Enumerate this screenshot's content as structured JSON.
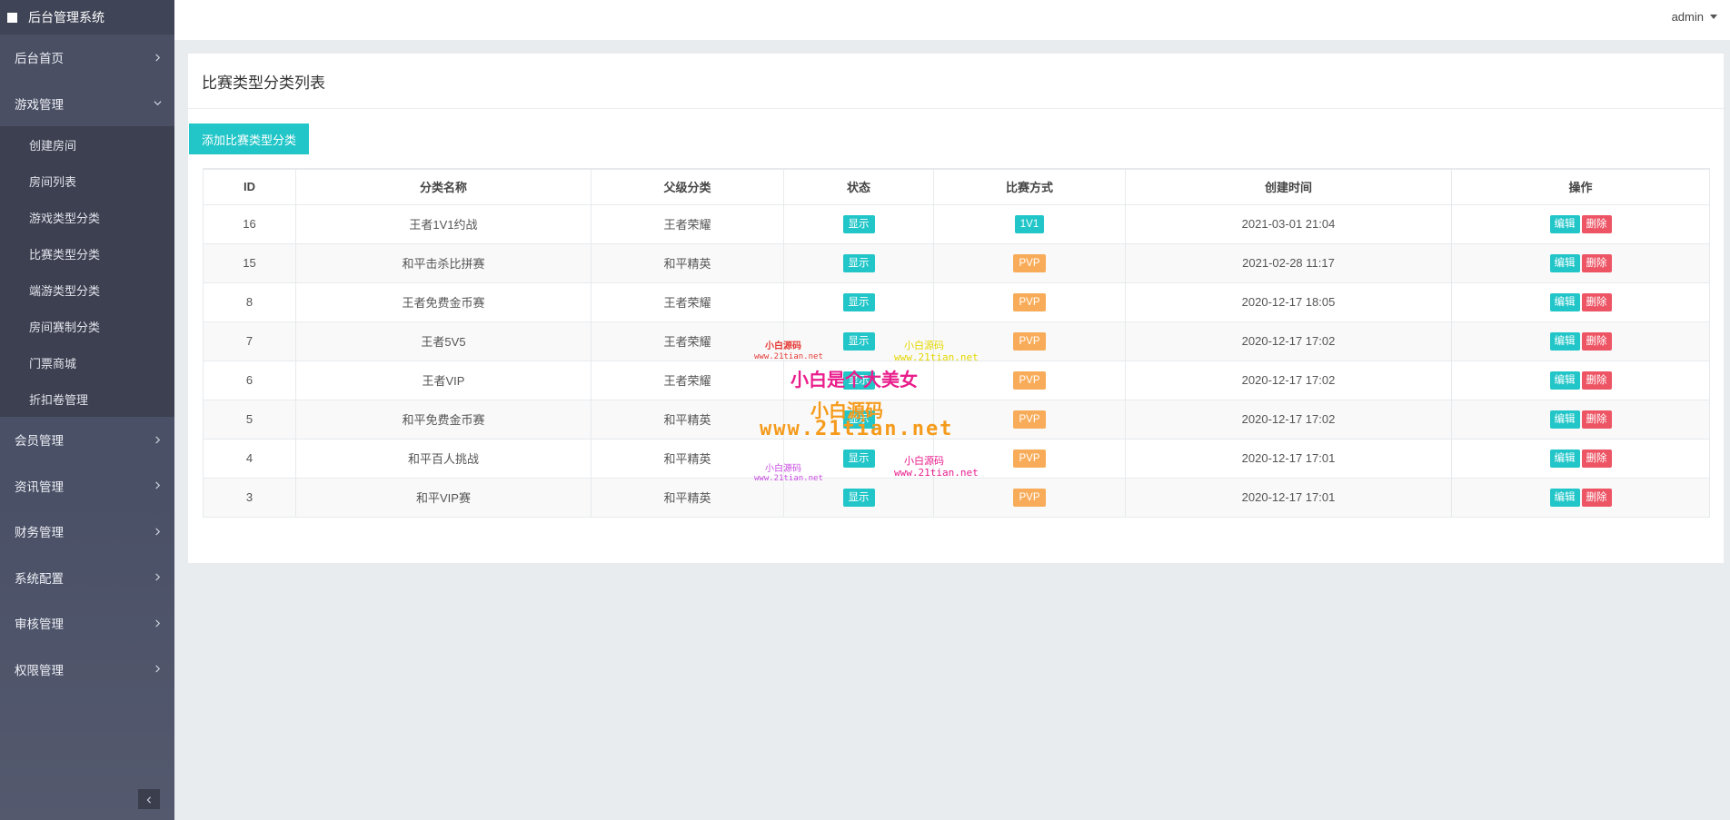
{
  "app": {
    "title": "后台管理系统"
  },
  "sidebar": {
    "items": [
      {
        "label": "后台首页"
      },
      {
        "label": "游戏管理",
        "expanded": true,
        "children": [
          "创建房间",
          "房间列表",
          "游戏类型分类",
          "比赛类型分类",
          "端游类型分类",
          "房间赛制分类",
          "门票商城",
          "折扣卷管理"
        ]
      },
      {
        "label": "会员管理"
      },
      {
        "label": "资讯管理"
      },
      {
        "label": "财务管理"
      },
      {
        "label": "系统配置"
      },
      {
        "label": "审核管理"
      },
      {
        "label": "权限管理"
      }
    ]
  },
  "header": {
    "user": "admin"
  },
  "page": {
    "title": "比赛类型分类列表",
    "add_button": "添加比赛类型分类"
  },
  "table": {
    "columns": [
      "ID",
      "分类名称",
      "父级分类",
      "状态",
      "比赛方式",
      "创建时间",
      "操作"
    ],
    "rows": [
      {
        "id": "16",
        "name": "王者1V1约战",
        "parent": "王者荣耀",
        "status": "显示",
        "mode": "1V1",
        "created": "2021-03-01 21:04"
      },
      {
        "id": "15",
        "name": "和平击杀比拼赛",
        "parent": "和平精英",
        "status": "显示",
        "mode": "PVP",
        "created": "2021-02-28 11:17"
      },
      {
        "id": "8",
        "name": "王者免费金币赛",
        "parent": "王者荣耀",
        "status": "显示",
        "mode": "PVP",
        "created": "2020-12-17 18:05"
      },
      {
        "id": "7",
        "name": "王者5V5",
        "parent": "王者荣耀",
        "status": "显示",
        "mode": "PVP",
        "created": "2020-12-17 17:02"
      },
      {
        "id": "6",
        "name": "王者VIP",
        "parent": "王者荣耀",
        "status": "显示",
        "mode": "PVP",
        "created": "2020-12-17 17:02"
      },
      {
        "id": "5",
        "name": "和平免费金币赛",
        "parent": "和平精英",
        "status": "显示",
        "mode": "PVP",
        "created": "2020-12-17 17:02"
      },
      {
        "id": "4",
        "name": "和平百人挑战",
        "parent": "和平精英",
        "status": "显示",
        "mode": "PVP",
        "created": "2020-12-17 17:01"
      },
      {
        "id": "3",
        "name": "和平VIP赛",
        "parent": "和平精英",
        "status": "显示",
        "mode": "PVP",
        "created": "2020-12-17 17:01"
      }
    ],
    "actions": {
      "edit": "编辑",
      "delete": "删除"
    }
  },
  "watermarks": {
    "w1": "小白源码",
    "w1_url": "www.21tian.net",
    "w2": "小白源码",
    "w2_url": "www.21tian.net",
    "w3": "小白是个大美女",
    "w4": "小白源码",
    "w4_url": "www.21tian.net",
    "w5": "小白源码",
    "w5_url": "www.21tian.net",
    "w6": "小白源码",
    "w6_url": "www.21tian.net"
  },
  "colors": {
    "primary": "#23c6c8",
    "warning": "#f8ac59",
    "danger": "#ed5565",
    "sidebar": "#4a4f63"
  }
}
